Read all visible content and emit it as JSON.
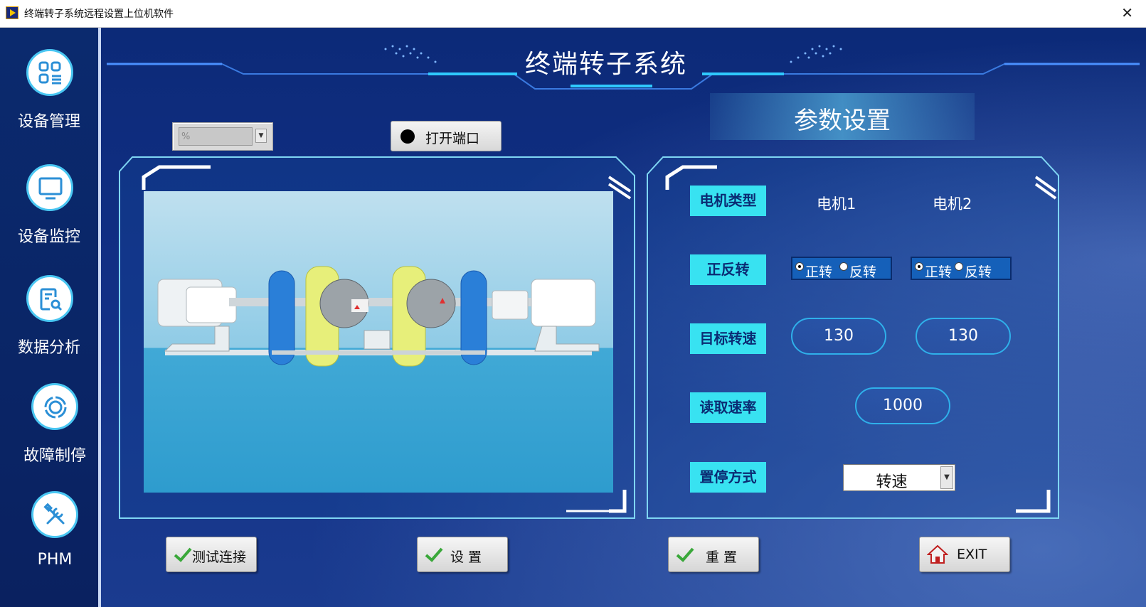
{
  "window": {
    "title": "终端转子系统远程设置上位机软件",
    "close": "✕"
  },
  "sidebar": {
    "items": [
      {
        "label": "设备管理",
        "icon": "grid-list-icon"
      },
      {
        "label": "设备监控",
        "icon": "monitor-icon"
      },
      {
        "label": "数据分析",
        "icon": "document-search-icon"
      },
      {
        "label": "故障制停",
        "icon": "ring-icon"
      },
      {
        "label": "PHM",
        "icon": "tools-icon"
      }
    ]
  },
  "header": {
    "title": "终端转子系统"
  },
  "port": {
    "combo_value": "%",
    "open_label": "打开端口"
  },
  "params": {
    "title": "参数设置",
    "motor_type_label": "电机类型",
    "motor1": "电机1",
    "motor2": "电机2",
    "direction_label": "正反转",
    "forward": "正转",
    "reverse": "反转",
    "target_speed_label": "目标转速",
    "target_speed_1": "130",
    "target_speed_2": "130",
    "read_rate_label": "读取速率",
    "read_rate": "1000",
    "stop_mode_label": "置停方式",
    "stop_mode": "转速"
  },
  "buttons": {
    "test": "测试连接",
    "set": "设  置",
    "reset": "重 置",
    "exit": "EXIT"
  },
  "colors": {
    "accent": "#38e2f1",
    "background": "#0c2a78",
    "frame": "#7fd6f3"
  }
}
